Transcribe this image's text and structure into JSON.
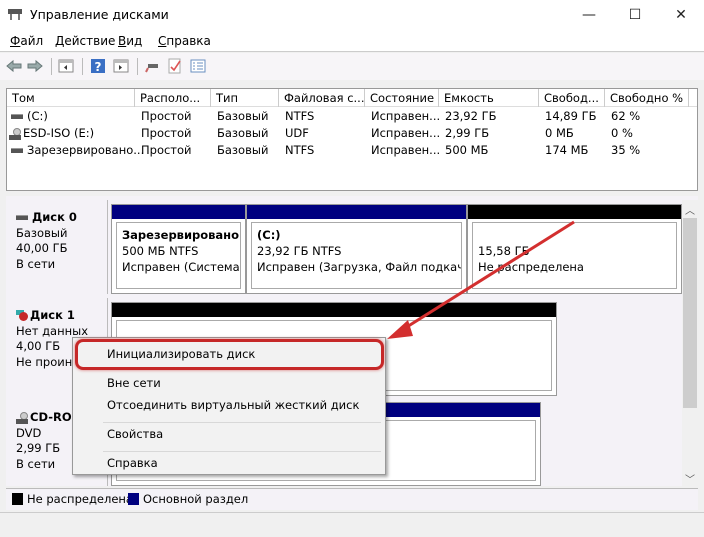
{
  "window": {
    "title": "Управление дисками",
    "minimize": "—",
    "maximize": "☐",
    "close": "✕"
  },
  "menu": {
    "items": [
      {
        "label": "Файл",
        "accel": "Ф",
        "rest": "айл"
      },
      {
        "label": "Действие",
        "accel": "Д",
        "rest": "ействие"
      },
      {
        "label": "Вид",
        "accel": "В",
        "rest": "ид"
      },
      {
        "label": "Справка",
        "accel": "С",
        "rest": "правка"
      }
    ]
  },
  "toolbar": {
    "icons": [
      "back-icon",
      "forward-icon",
      "console-tree-icon",
      "help-icon",
      "action-pane-icon",
      "connect-icon",
      "check-icon",
      "properties-icon"
    ]
  },
  "volumes": {
    "columns": [
      "Том",
      "Располо...",
      "Тип",
      "Файловая с...",
      "Состояние",
      "Емкость",
      "Свобод...",
      "Свободно %"
    ],
    "rows": [
      {
        "icon": "hdd",
        "name": "(C:)",
        "layout": "Простой",
        "type": "Базовый",
        "fs": "NTFS",
        "status": "Исправен...",
        "capacity": "23,92 ГБ",
        "free": "14,89 ГБ",
        "free_pct": "62 %"
      },
      {
        "icon": "cd",
        "name": "ESD-ISO (E:)",
        "layout": "Простой",
        "type": "Базовый",
        "fs": "UDF",
        "status": "Исправен...",
        "capacity": "2,99 ГБ",
        "free": "0 МБ",
        "free_pct": "0 %"
      },
      {
        "icon": "hdd",
        "name": "Зарезервировано...",
        "layout": "Простой",
        "type": "Базовый",
        "fs": "NTFS",
        "status": "Исправен...",
        "capacity": "500 МБ",
        "free": "174 МБ",
        "free_pct": "35 %"
      }
    ]
  },
  "disks": [
    {
      "name": "Диск 0",
      "kind": "Базовый",
      "size": "40,00 ГБ",
      "state": "В сети",
      "partitions": [
        {
          "title": "Зарезервировано си",
          "line2": "500 МБ NTFS",
          "line3": "Исправен (Система, А"
        },
        {
          "title": "(C:)",
          "line2": "23,92 ГБ NTFS",
          "line3": "Исправен (Загрузка, Файл подкачки,"
        },
        {
          "title": "",
          "line2": "15,58 ГБ",
          "line3": "Не распределена"
        }
      ]
    },
    {
      "name": "Диск 1",
      "kind": "Нет данных",
      "size": "4,00 ГБ",
      "state": "Не проини"
    },
    {
      "name": "CD-RO",
      "kind": "DVD",
      "size": "2,99 ГБ",
      "state": "В сети"
    }
  ],
  "context_menu": {
    "items": [
      "Инициализировать диск",
      "Вне сети",
      "Отсоединить виртуальный жесткий диск",
      "Свойства",
      "Справка"
    ]
  },
  "legend": {
    "items": [
      {
        "label": "Не распределена",
        "color": "#000000"
      },
      {
        "label": "Основной раздел",
        "color": "#000080"
      }
    ]
  },
  "colors": {
    "primary_partition": "#000080",
    "unallocated": "#000000",
    "annotation": "#d32f2f"
  }
}
